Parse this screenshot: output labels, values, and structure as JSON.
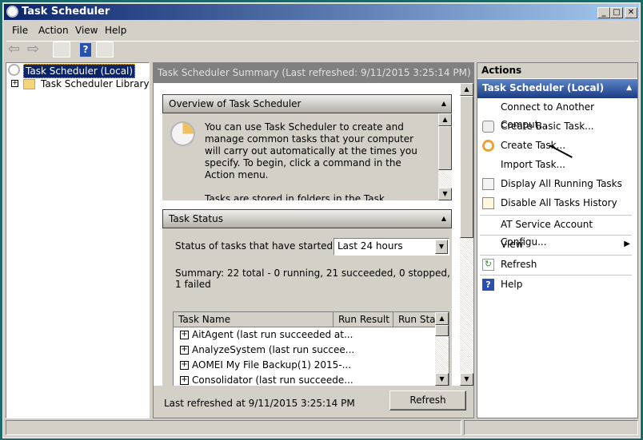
{
  "window": {
    "title": "Task Scheduler"
  },
  "menu": [
    "File",
    "Action",
    "View",
    "Help"
  ],
  "tree": {
    "root": "Task Scheduler (Local)",
    "child": "Task Scheduler Library"
  },
  "center": {
    "header": "Task Scheduler Summary (Last refreshed: 9/11/2015 3:25:14 PM)",
    "overview": {
      "title": "Overview of Task Scheduler",
      "p1": "You can use Task Scheduler to create and manage common tasks that your computer will carry out automatically at the times you specify. To begin, click a command in the Action menu.",
      "p2": "Tasks are stored in folders in the Task Scheduler Library. To view or perform an operation on an"
    },
    "status": {
      "title": "Task Status",
      "label": "Status of tasks that have started in...",
      "select": "Last 24 hours",
      "summary": "Summary: 22 total - 0 running, 21 succeeded, 0 stopped, 1 failed",
      "columns": [
        "Task Name",
        "Run Result",
        "Run Star"
      ],
      "rows": [
        "AitAgent (last run succeeded at...",
        "AnalyzeSystem (last run succee...",
        "AOMEI My File Backup(1) 2015-...",
        "Consolidator (last run succeede..."
      ]
    },
    "footer": {
      "refreshed": "Last refreshed at 9/11/2015 3:25:14 PM",
      "refresh": "Refresh"
    }
  },
  "actions": {
    "header": "Actions",
    "group": "Task Scheduler (Local)",
    "items": [
      "Connect to Another Comput...",
      "Create Basic Task...",
      "Create Task...",
      "Import Task...",
      "Display All Running Tasks",
      "Disable All Tasks History",
      "AT Service Account Configu...",
      "View",
      "Refresh",
      "Help"
    ]
  }
}
